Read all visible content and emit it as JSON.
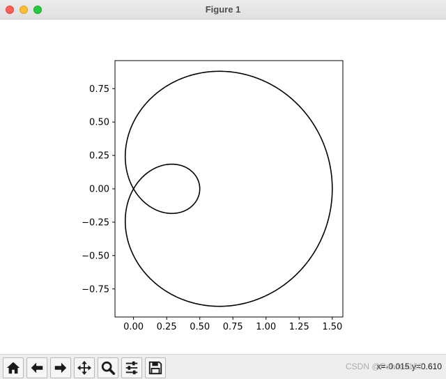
{
  "window": {
    "title": "Figure 1"
  },
  "toolbar": {
    "buttons": [
      {
        "name": "home-button",
        "icon": "home-icon"
      },
      {
        "name": "back-button",
        "icon": "arrow-left-icon"
      },
      {
        "name": "forward-button",
        "icon": "arrow-right-icon"
      },
      {
        "name": "pan-button",
        "icon": "move-icon"
      },
      {
        "name": "zoom-button",
        "icon": "magnifier-icon"
      },
      {
        "name": "configure-subplots-button",
        "icon": "sliders-icon"
      },
      {
        "name": "save-button",
        "icon": "floppy-disk-icon"
      }
    ],
    "status": "x=-0.015 y=0.610"
  },
  "watermark": "CSDN @Pandas120",
  "chart_data": {
    "type": "line",
    "curve": "limacon r = 0.5 + cos(θ)",
    "title": "",
    "xlabel": "",
    "ylabel": "",
    "xlim": [
      -0.14,
      1.58
    ],
    "ylim": [
      -0.96,
      0.96
    ],
    "xticks": [
      "0.00",
      "0.25",
      "0.50",
      "0.75",
      "1.00",
      "1.25",
      "1.50"
    ],
    "xtick_values": [
      0,
      0.25,
      0.5,
      0.75,
      1.0,
      1.25,
      1.5
    ],
    "yticks": [
      "−0.75",
      "−0.50",
      "−0.25",
      "0.00",
      "0.25",
      "0.50",
      "0.75"
    ],
    "ytick_values": [
      -0.75,
      -0.5,
      -0.25,
      0,
      0.25,
      0.5,
      0.75
    ],
    "grid": false,
    "line_color": "#000000",
    "x": [],
    "y": []
  }
}
